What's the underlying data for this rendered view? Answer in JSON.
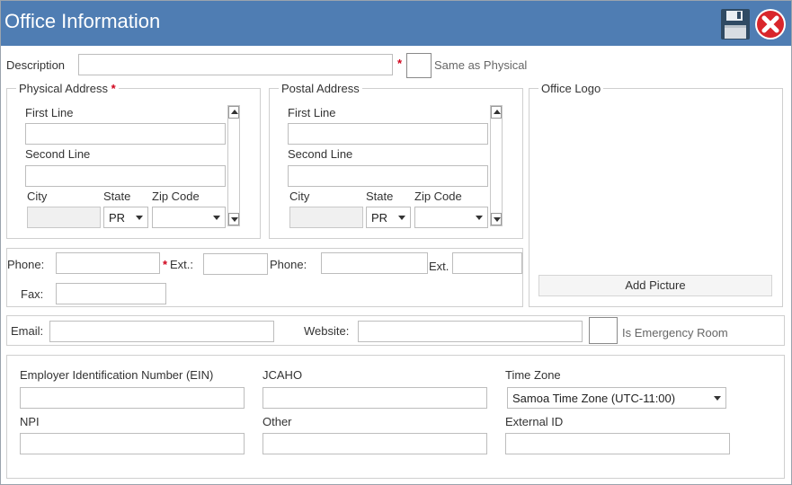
{
  "window": {
    "title": "Office Information"
  },
  "colors": {
    "titlebar": "#4f7db3",
    "required": "#d0021b"
  },
  "icons": {
    "save": "floppy-disk-icon",
    "close": "close-circle-icon"
  },
  "description": {
    "label": "Description",
    "value": "",
    "required_mark": "*",
    "same_as_physical_label": "Same as Physical"
  },
  "physical_address": {
    "legend": "Physical Address",
    "required_mark": "*",
    "first_line_label": "First Line",
    "first_line_value": "",
    "second_line_label": "Second Line",
    "second_line_value": "",
    "city_label": "City",
    "city_value": "",
    "state_label": "State",
    "state_value": "PR",
    "zip_label": "Zip Code",
    "zip_value": ""
  },
  "postal_address": {
    "legend": "Postal Address",
    "first_line_label": "First Line",
    "first_line_value": "",
    "second_line_label": "Second Line",
    "second_line_value": "",
    "city_label": "City",
    "city_value": "",
    "state_label": "State",
    "state_value": "PR",
    "zip_label": "Zip Code",
    "zip_value": ""
  },
  "office_logo": {
    "legend": "Office Logo",
    "add_picture_label": "Add Picture"
  },
  "phones": {
    "phone1_label": "Phone:",
    "phone1_value": "",
    "ext1_required_mark": "*",
    "ext1_label": "Ext.:",
    "ext1_value": "",
    "phone2_label": "Phone:",
    "phone2_value": "",
    "ext2_label": "Ext.",
    "ext2_value": "",
    "fax_label": "Fax:",
    "fax_value": ""
  },
  "contact": {
    "email_label": "Email:",
    "email_value": "",
    "website_label": "Website:",
    "website_value": "",
    "emergency_label": "Is Emergency Room"
  },
  "ids": {
    "ein_label": "Employer Identification Number (EIN)",
    "ein_value": "",
    "jcaho_label": "JCAHO",
    "jcaho_value": "",
    "timezone_label": "Time Zone",
    "timezone_value": "Samoa Time Zone (UTC-11:00)",
    "npi_label": "NPI",
    "npi_value": "",
    "other_label": "Other",
    "other_value": "",
    "external_id_label": "External ID",
    "external_id_value": ""
  }
}
